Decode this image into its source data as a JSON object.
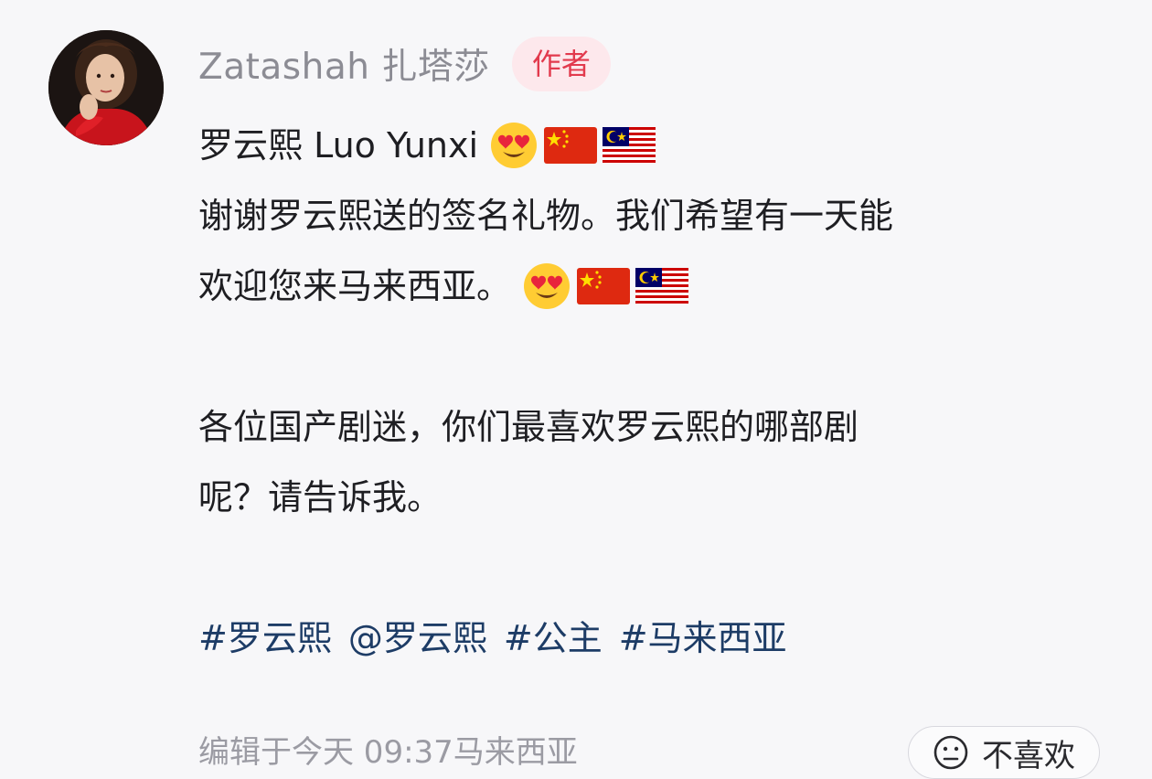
{
  "author": {
    "name": "Zatashah 扎塔莎",
    "badge": "作者"
  },
  "post": {
    "line1": "罗云熙 Luo Yunxi",
    "line2": "谢谢罗云熙送的签名礼物。我们希望有一天能",
    "line3": "欢迎您来马来西亚。",
    "line4": "各位国产剧迷，你们最喜欢罗云熙的哪部剧",
    "line5": "呢？请告诉我。",
    "emoji_set": [
      "heart-eyes-face-icon",
      "china-flag-icon",
      "malaysia-flag-icon"
    ]
  },
  "tags": [
    "#罗云熙",
    "@罗云熙",
    "#公主",
    "#马来西亚"
  ],
  "meta": {
    "edited": "编辑于今天 09:37马来西亚"
  },
  "actions": {
    "dislike_label": "不喜欢"
  },
  "colors": {
    "background": "#f7f7f9",
    "tag_blue": "#1d3c66",
    "badge_red": "#e23a4d",
    "badge_bg": "#fde8ec"
  }
}
